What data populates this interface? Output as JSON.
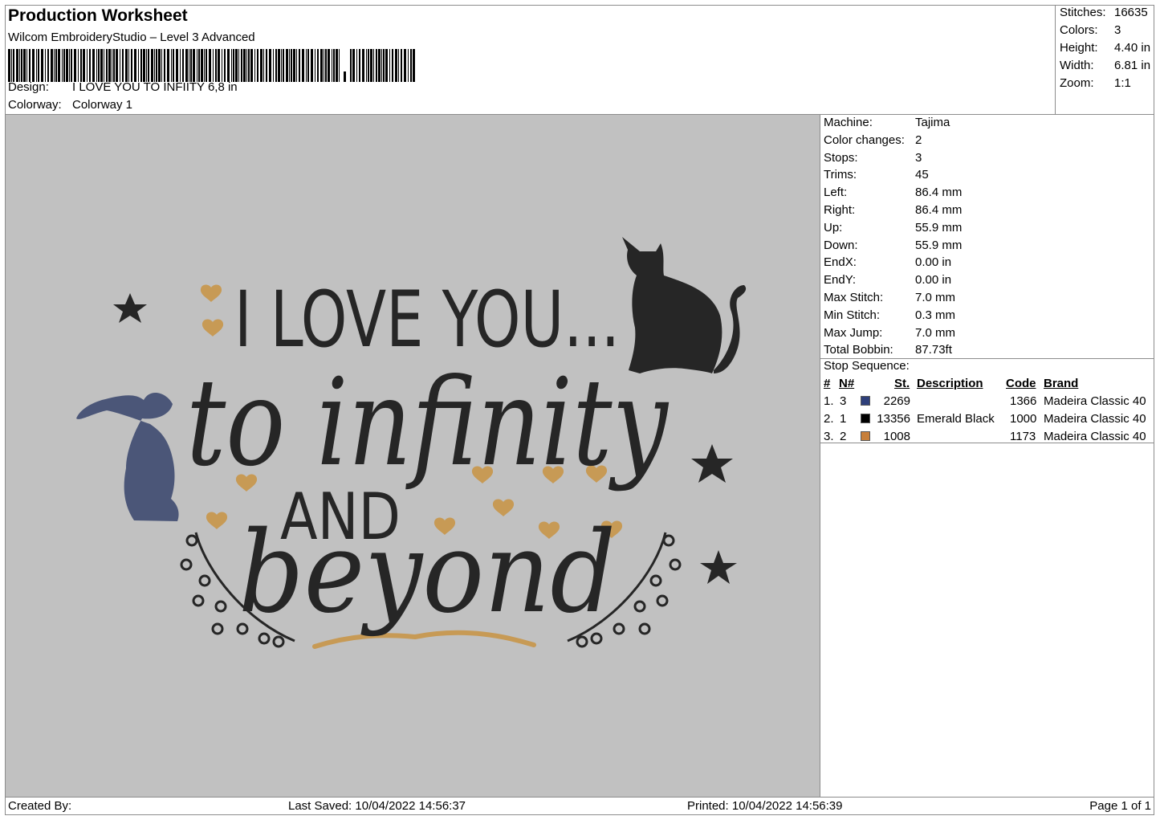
{
  "header": {
    "title": "Production Worksheet",
    "software": "Wilcom EmbroideryStudio – Level 3 Advanced",
    "design_label": "Design:",
    "design_value": "I LOVE YOU TO INFIITY 6,8 in",
    "colorway_label": "Colorway:",
    "colorway_value": "Colorway 1"
  },
  "summary": [
    {
      "label": "Stitches:",
      "value": "16635"
    },
    {
      "label": "Colors:",
      "value": "3"
    },
    {
      "label": "Height:",
      "value": "4.40 in"
    },
    {
      "label": "Width:",
      "value": "6.81 in"
    },
    {
      "label": "Zoom:",
      "value": "1:1"
    }
  ],
  "properties": [
    {
      "label": "Machine:",
      "value": "Tajima"
    },
    {
      "label": "Color changes:",
      "value": "2"
    },
    {
      "label": "Stops:",
      "value": "3"
    },
    {
      "label": "Trims:",
      "value": "45"
    },
    {
      "label": "Left:",
      "value": "86.4 mm"
    },
    {
      "label": "Right:",
      "value": "86.4 mm"
    },
    {
      "label": "Up:",
      "value": "55.9 mm"
    },
    {
      "label": "Down:",
      "value": "55.9 mm"
    },
    {
      "label": "EndX:",
      "value": "0.00 in"
    },
    {
      "label": "EndY:",
      "value": "0.00 in"
    },
    {
      "label": "Max Stitch:",
      "value": "7.0 mm"
    },
    {
      "label": "Min Stitch:",
      "value": "0.3 mm"
    },
    {
      "label": "Max Jump:",
      "value": "7.0 mm"
    },
    {
      "label": "Total Bobbin:",
      "value": "87.73ft"
    }
  ],
  "stop_sequence": {
    "label": "Stop Sequence:",
    "columns": {
      "num": "#",
      "needle": "N#",
      "stitches": "St.",
      "description": "Description",
      "code": "Code",
      "brand": "Brand"
    },
    "rows": [
      {
        "num": "1.",
        "needle": "3",
        "color": "#2e3f7a",
        "stitches": "2269",
        "description": "",
        "code": "1366",
        "brand": "Madeira Classic 40"
      },
      {
        "num": "2.",
        "needle": "1",
        "color": "#000000",
        "stitches": "13356",
        "description": "Emerald Black",
        "code": "1000",
        "brand": "Madeira Classic 40"
      },
      {
        "num": "3.",
        "needle": "2",
        "color": "#c77f3a",
        "stitches": "1008",
        "description": "",
        "code": "1173",
        "brand": "Madeira Classic 40"
      }
    ]
  },
  "design_preview": {
    "line1": "I LOVE YOU...",
    "line2": "to infinity",
    "line3": "AND",
    "line4": "beyond",
    "colors": {
      "black": "#262626",
      "blue": "#4b5678",
      "gold": "#c79a55",
      "background": "#c1c1c1"
    }
  },
  "footer": {
    "created_by": "Created By:",
    "last_saved": "Last Saved: 10/04/2022 14:56:37",
    "printed": "Printed: 10/04/2022 14:56:39",
    "page": "Page 1 of 1"
  }
}
